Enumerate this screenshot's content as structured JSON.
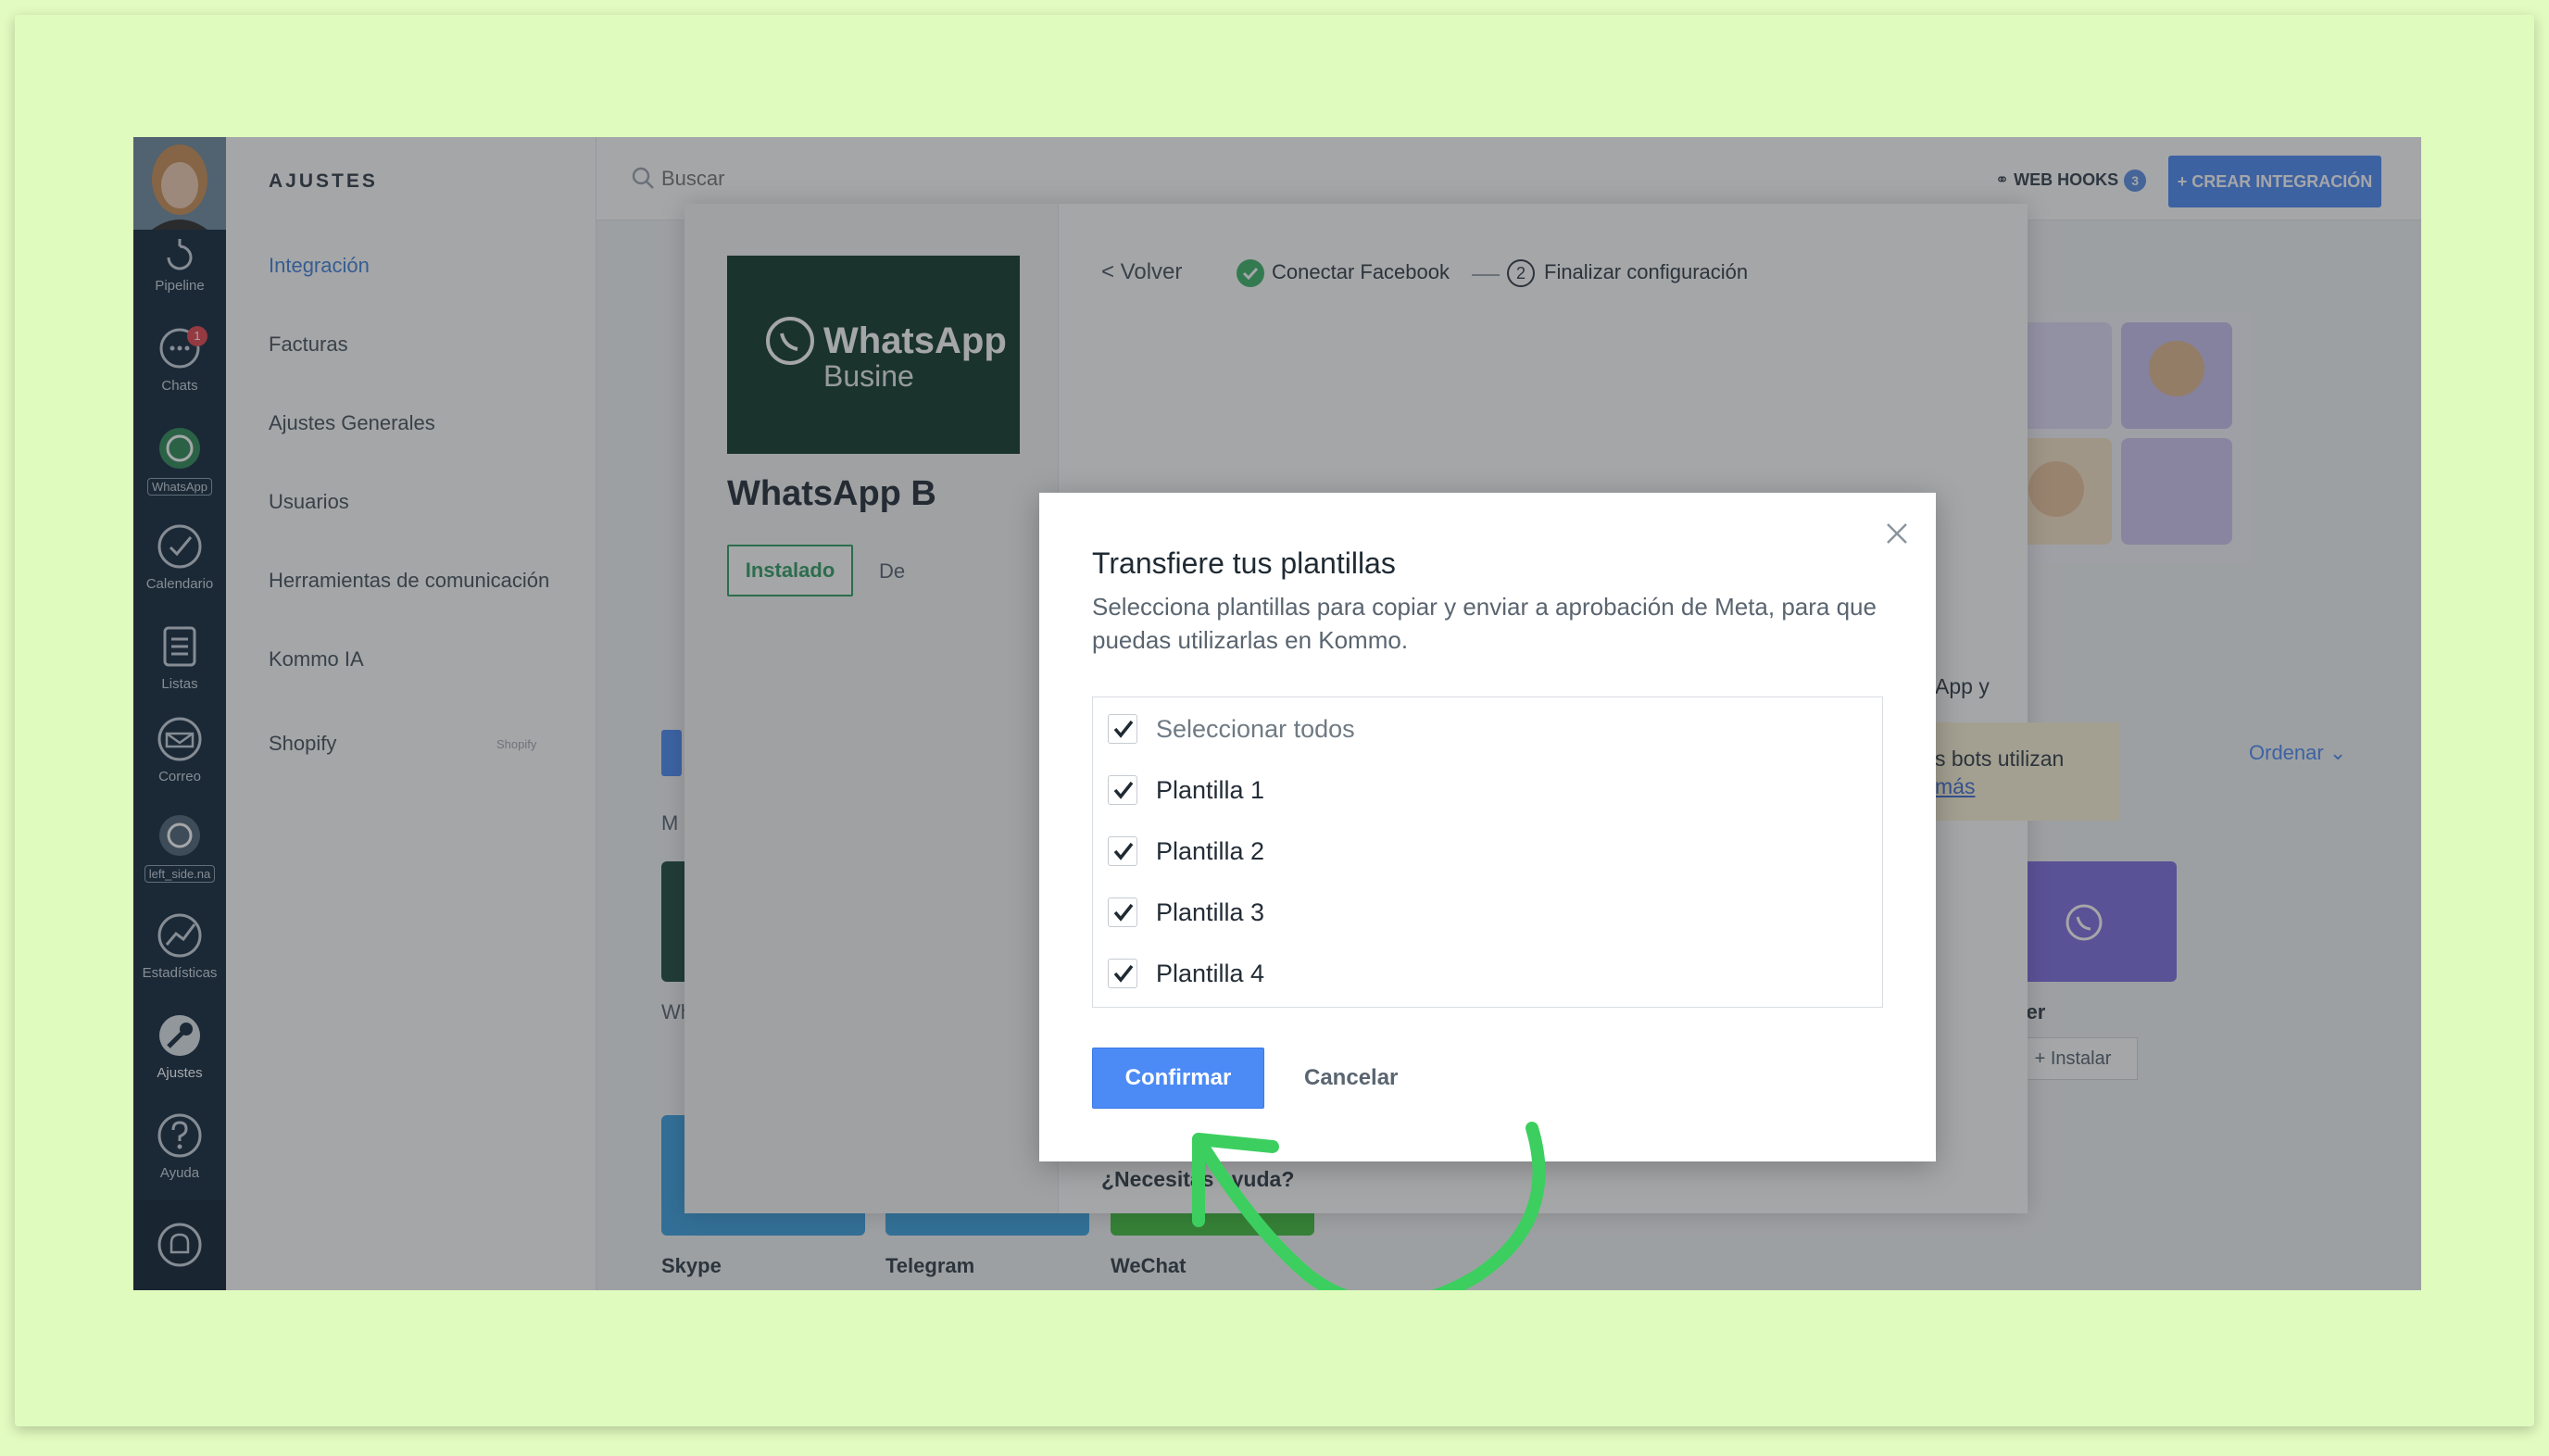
{
  "leftnav": {
    "items": [
      {
        "label": "Pipeline"
      },
      {
        "label": "Chats",
        "badge": "1"
      },
      {
        "label": "WhatsApp"
      },
      {
        "label": "Calendario"
      },
      {
        "label": "Listas"
      },
      {
        "label": "Correo"
      },
      {
        "label": "left_side.na"
      },
      {
        "label": "Estadísticas"
      },
      {
        "label": "Ajustes"
      },
      {
        "label": "Ayuda"
      }
    ]
  },
  "settings": {
    "title": "AJUSTES",
    "items": [
      {
        "label": "Integración"
      },
      {
        "label": "Facturas"
      },
      {
        "label": "Ajustes Generales"
      },
      {
        "label": "Usuarios"
      },
      {
        "label": "Herramientas de comunicación"
      },
      {
        "label": "Kommo IA"
      },
      {
        "label": "Shopify",
        "tag": "Shopify"
      }
    ]
  },
  "topbar": {
    "search_placeholder": "Buscar",
    "webhooks_label": "WEB HOOKS",
    "webhooks_count": "3",
    "create_label": "+ CREAR INTEGRACIÓN"
  },
  "background": {
    "ordenar": "Ordenar",
    "m_text": "M",
    "w_text": "Wh",
    "viber_label": "iber",
    "instalar_label": "+ Instalar",
    "tiles": [
      {
        "label": "Skype"
      },
      {
        "label": "Telegram"
      },
      {
        "label": "WeChat"
      }
    ]
  },
  "detail": {
    "logo_text": "WhatsApp",
    "logo_sub": "Busine",
    "title": "WhatsApp B",
    "installed_label": "Instalado",
    "tab_peek": "De",
    "back_label": "< Volver",
    "step1_label": "Conectar Facebook",
    "step2_num": "2",
    "step2_label": "Finalizar configuración",
    "peek_line1": "App y",
    "peek_line2": "s bots utilizan",
    "peek_link": "más",
    "help_question": "¿Necesitas ayuda?"
  },
  "modal": {
    "title": "Transfiere tus plantillas",
    "description": "Selecciona plantillas para copiar y enviar a aprobación de Meta, para que puedas utilizarlas en Kommo.",
    "select_all": "Seleccionar todos",
    "templates": [
      {
        "label": "Plantilla 1",
        "checked": true
      },
      {
        "label": "Plantilla 2",
        "checked": true
      },
      {
        "label": "Plantilla 3",
        "checked": true
      },
      {
        "label": "Plantilla 4",
        "checked": true
      }
    ],
    "confirm_label": "Confirmar",
    "cancel_label": "Cancelar"
  },
  "colors": {
    "accent": "#4c8bf5",
    "nav_bg": "#12293d",
    "installed": "#2f9e63",
    "arrow": "#3ccf5f",
    "frame_bg": "#e2fbc0"
  }
}
